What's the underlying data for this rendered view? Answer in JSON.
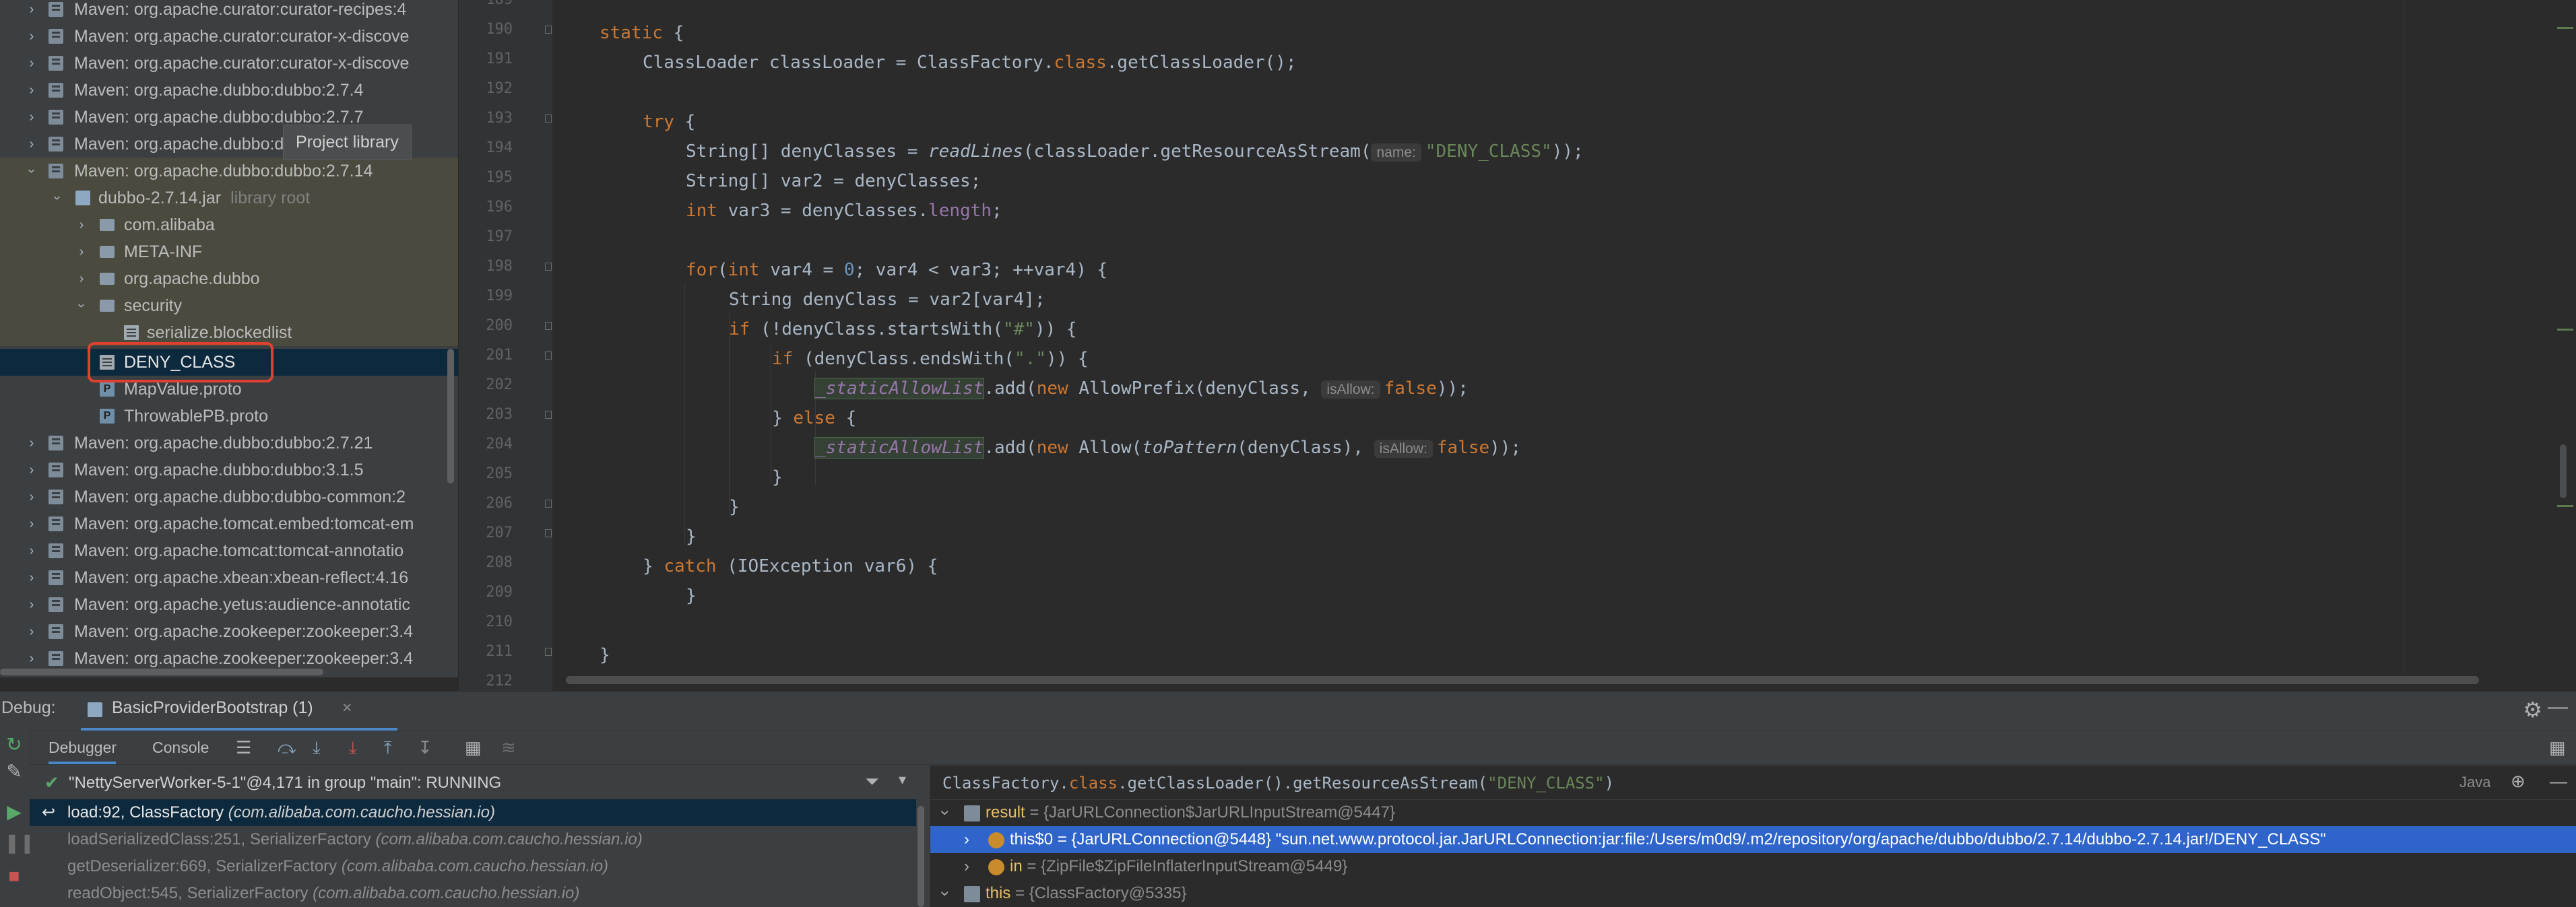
{
  "tree": {
    "tooltip": "Project library",
    "rows": [
      {
        "label": "Maven: org.apache.curator:curator-recipes:4",
        "note": ""
      },
      {
        "label": "Maven: org.apache.curator:curator-x-discove",
        "note": ""
      },
      {
        "label": "Maven: org.apache.curator:curator-x-discove",
        "note": ""
      },
      {
        "label": "Maven: org.apache.dubbo:dubbo:2.7.4",
        "note": ""
      },
      {
        "label": "Maven: org.apache.dubbo:dubbo:2.7.7",
        "note": ""
      },
      {
        "label": "Maven: org.apache.dubbo:dubbo:2.7.8",
        "note": ""
      },
      {
        "label": "Maven: org.apache.dubbo:dubbo:2.7.14",
        "note": ""
      },
      {
        "label": "dubbo-2.7.14.jar",
        "note": "library root"
      },
      {
        "label": "com.alibaba",
        "note": ""
      },
      {
        "label": "META-INF",
        "note": ""
      },
      {
        "label": "org.apache.dubbo",
        "note": ""
      },
      {
        "label": "security",
        "note": ""
      },
      {
        "label": "serialize.blockedlist",
        "note": ""
      },
      {
        "label": "DENY_CLASS",
        "note": ""
      },
      {
        "label": "MapValue.proto",
        "note": ""
      },
      {
        "label": "ThrowablePB.proto",
        "note": ""
      },
      {
        "label": "Maven: org.apache.dubbo:dubbo:2.7.21",
        "note": ""
      },
      {
        "label": "Maven: org.apache.dubbo:dubbo:3.1.5",
        "note": ""
      },
      {
        "label": "Maven: org.apache.dubbo:dubbo-common:2",
        "note": ""
      },
      {
        "label": "Maven: org.apache.tomcat.embed:tomcat-em",
        "note": ""
      },
      {
        "label": "Maven: org.apache.tomcat:tomcat-annotatio",
        "note": ""
      },
      {
        "label": "Maven: org.apache.xbean:xbean-reflect:4.16",
        "note": ""
      },
      {
        "label": "Maven: org.apache.yetus:audience-annotatic",
        "note": ""
      },
      {
        "label": "Maven: org.apache.zookeeper:zookeeper:3.4",
        "note": ""
      },
      {
        "label": "Maven: org.apache.zookeeper:zookeeper:3.4",
        "note": ""
      }
    ]
  },
  "editor": {
    "line_numbers": [
      "189",
      "190",
      "191",
      "192",
      "193",
      "194",
      "195",
      "196",
      "197",
      "198",
      "199",
      "200",
      "201",
      "202",
      "203",
      "204",
      "205",
      "206",
      "207",
      "208",
      "209",
      "210",
      "211",
      "212"
    ],
    "lines": {
      "l190_kw": "static",
      "l190_rest": " {",
      "l191": "ClassLoader classLoader = ClassFactory.",
      "l191_kw": "class",
      "l191_rest": ".getClassLoader();",
      "l193_kw": "try",
      "l193_rest": " {",
      "l194_a": "String[] denyClasses = ",
      "l194_m": "readLines",
      "l194_b": "(classLoader.getResourceAsStream(",
      "l194_hint": "name:",
      "l194_str": "\"DENY_CLASS\"",
      "l194_c": "));",
      "l195": "String[] var2 = denyClasses;",
      "l196_kw": "int",
      "l196_a": " var3 = denyClasses.",
      "l196_f": "length",
      "l196_b": ";",
      "l198_kw1": "for",
      "l198_a": "(",
      "l198_kw2": "int",
      "l198_b": " var4 = ",
      "l198_n": "0",
      "l198_c": "; var4 < var3; ++var4) {",
      "l199": "String denyClass = var2[var4];",
      "l200_kw": "if",
      "l200_a": " (!denyClass.startsWith(",
      "l200_str": "\"#\"",
      "l200_b": ")) {",
      "l201_kw": "if",
      "l201_a": " (denyClass.endsWith(",
      "l201_str": "\".\"",
      "l201_b": ")) {",
      "l202_f": "_staticAllowList",
      "l202_a": ".add(",
      "l202_kw": "new",
      "l202_b": " AllowPrefix(denyClass, ",
      "l202_hint": "isAllow:",
      "l202_kw2": "false",
      "l202_c": "));",
      "l203_a": "} ",
      "l203_kw": "else",
      "l203_b": " {",
      "l204_f": "_staticAllowList",
      "l204_a": ".add(",
      "l204_kw": "new",
      "l204_b": " Allow(",
      "l204_m": "toPattern",
      "l204_c": "(denyClass), ",
      "l204_hint": "isAllow:",
      "l204_kw2": "false",
      "l204_d": "));",
      "l205": "}",
      "l206": "}",
      "l207": "}",
      "l208_a": "} ",
      "l208_kw": "catch",
      "l208_b": " (IOException var6) {",
      "l209": "}",
      "l211": "}"
    }
  },
  "debug": {
    "label": "Debug:",
    "tab_name": "BasicProviderBootstrap (1)",
    "tab_close": "×",
    "tabs": {
      "debugger": "Debugger",
      "console": "Console"
    },
    "thread": "\"NettyServerWorker-5-1\"@4,171 in group \"main\": RUNNING",
    "frames": [
      {
        "method": "load:92, ClassFactory",
        "pkg": "(com.alibaba.com.caucho.hessian.io)"
      },
      {
        "method": "loadSerializedClass:251, SerializerFactory",
        "pkg": "(com.alibaba.com.caucho.hessian.io)"
      },
      {
        "method": "getDeserializer:669, SerializerFactory",
        "pkg": "(com.alibaba.com.caucho.hessian.io)"
      },
      {
        "method": "readObject:545, SerializerFactory",
        "pkg": "(com.alibaba.com.caucho.hessian.io)"
      }
    ],
    "eval": {
      "a": "ClassFactory.",
      "kw": "class",
      "b": ".getClassLoader().getResourceAsStream(",
      "str": "\"DENY_CLASS\"",
      "c": ")",
      "lang": "Java"
    },
    "vars": [
      {
        "name": "result",
        "value": " = {JarURLConnection$JarURLInputStream@5447}"
      },
      {
        "name": "this$0",
        "value": " = {JarURLConnection@5448} \"sun.net.www.protocol.jar.JarURLConnection:jar:file:/Users/m0d9/.m2/repository/org/apache/dubbo/dubbo/2.7.14/dubbo-2.7.14.jar!/DENY_CLASS\""
      },
      {
        "name": "in",
        "value": " = {ZipFile$ZipFileInflaterInputStream@5449}"
      },
      {
        "name": "this",
        "value": " = {ClassFactory@5335}"
      }
    ]
  },
  "colors": {
    "keyword": "#cc7832",
    "string": "#6a8759",
    "number": "#6897bb",
    "field": "#9876aa",
    "selection": "#2f65ca",
    "highlight_box": "#e0412f"
  }
}
